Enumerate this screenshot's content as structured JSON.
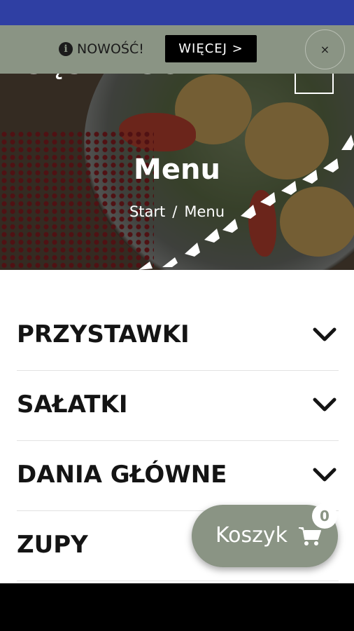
{
  "hero": {
    "logo_fragment": "GĘSILEGO",
    "title": "Menu",
    "breadcrumb": {
      "home": "Start",
      "separator": "/",
      "current": "Menu"
    }
  },
  "notice": {
    "info_icon": "i",
    "label": "NOWOŚĆ!",
    "more_button": "WIĘCEJ >",
    "close_label": "×"
  },
  "categories": [
    {
      "label": "PRZYSTAWKI"
    },
    {
      "label": "SAŁATKI"
    },
    {
      "label": "DANIA GŁÓWNE"
    },
    {
      "label": "ZUPY"
    }
  ],
  "cart": {
    "label": "Koszyk",
    "count": "0",
    "icon": "shopping-cart-icon"
  },
  "colors": {
    "status_bar": "#2f3fa3",
    "accent_sage": "#8a9484",
    "text_dark": "#141414"
  }
}
